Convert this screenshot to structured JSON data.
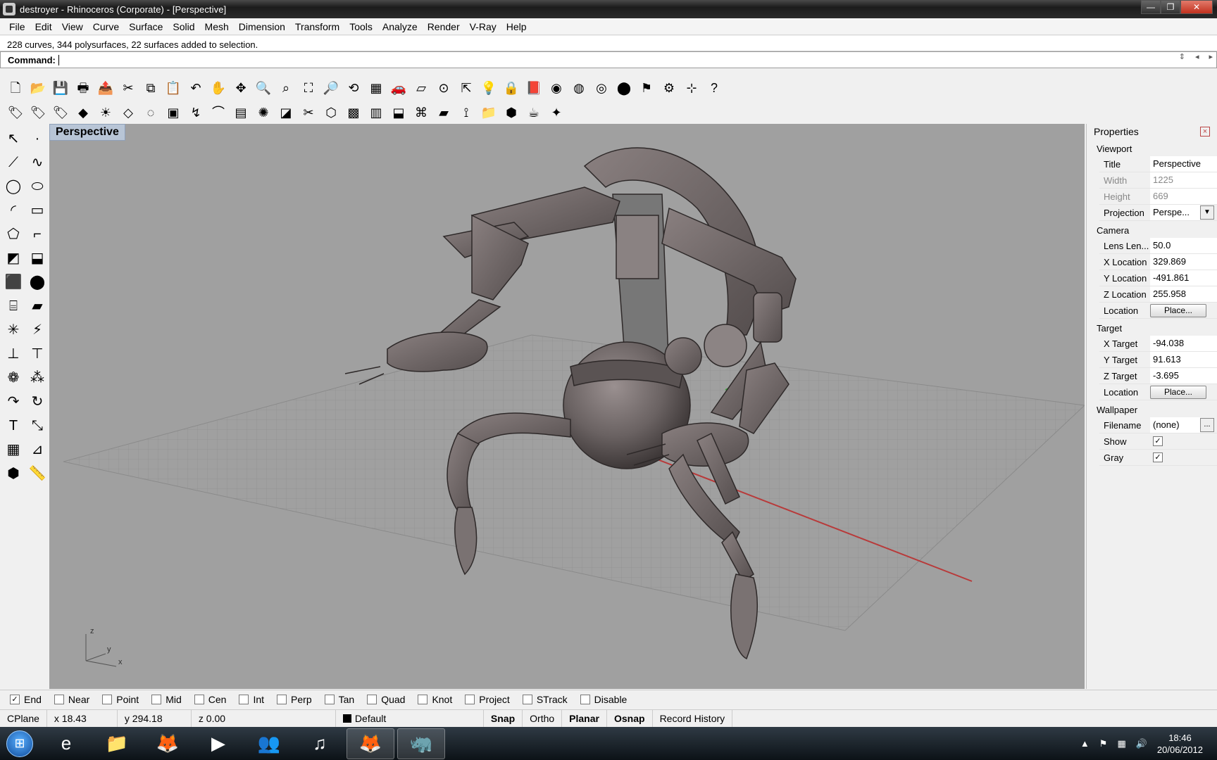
{
  "window": {
    "title": "destroyer - Rhinoceros (Corporate) - [Perspective]"
  },
  "menu": [
    "File",
    "Edit",
    "View",
    "Curve",
    "Surface",
    "Solid",
    "Mesh",
    "Dimension",
    "Transform",
    "Tools",
    "Analyze",
    "Render",
    "V-Ray",
    "Help"
  ],
  "command": {
    "history": "228 curves, 344 polysurfaces, 22 surfaces added to selection.",
    "prompt": "Command:"
  },
  "toolbar1": [
    {
      "icon": "new-icon",
      "glyph": "🗋"
    },
    {
      "icon": "open-icon",
      "glyph": "📂"
    },
    {
      "icon": "save-icon",
      "glyph": "💾"
    },
    {
      "icon": "print-icon",
      "glyph": "🖶"
    },
    {
      "icon": "export-icon",
      "glyph": "📤"
    },
    {
      "icon": "cut-icon",
      "glyph": "✂"
    },
    {
      "icon": "copy-icon",
      "glyph": "⧉"
    },
    {
      "icon": "paste-icon",
      "glyph": "📋"
    },
    {
      "icon": "undo-icon",
      "glyph": "↶"
    },
    {
      "icon": "pan-icon",
      "glyph": "✋"
    },
    {
      "icon": "rotate-view-icon",
      "glyph": "✥"
    },
    {
      "icon": "zoom-icon",
      "glyph": "🔍"
    },
    {
      "icon": "zoom-window-icon",
      "glyph": "⌕"
    },
    {
      "icon": "zoom-extents-icon",
      "glyph": "⛶"
    },
    {
      "icon": "zoom-selected-icon",
      "glyph": "🔎"
    },
    {
      "icon": "undo-view-icon",
      "glyph": "⟲"
    },
    {
      "icon": "four-viewports-icon",
      "glyph": "▦"
    },
    {
      "icon": "render-preview-icon",
      "glyph": "🚗"
    },
    {
      "icon": "cplane-icon",
      "glyph": "▱"
    },
    {
      "icon": "point-on-icon",
      "glyph": "⊙"
    },
    {
      "icon": "gumball-icon",
      "glyph": "⇱"
    },
    {
      "icon": "light-icon",
      "glyph": "💡"
    },
    {
      "icon": "lock-icon",
      "glyph": "🔒"
    },
    {
      "icon": "layer-icon",
      "glyph": "📕"
    },
    {
      "icon": "color-wheel-icon",
      "glyph": "◉"
    },
    {
      "icon": "wireframe-icon",
      "glyph": "◍"
    },
    {
      "icon": "shaded-icon",
      "glyph": "◎"
    },
    {
      "icon": "render-sphere-icon",
      "glyph": "⬤"
    },
    {
      "icon": "flag-icon",
      "glyph": "⚑"
    },
    {
      "icon": "options-gear-icon",
      "glyph": "⚙"
    },
    {
      "icon": "dimension-icon",
      "glyph": "⊹"
    },
    {
      "icon": "help-icon",
      "glyph": "?"
    }
  ],
  "toolbar2": [
    {
      "icon": "tag-icon",
      "glyph": "🏷"
    },
    {
      "icon": "tag-edit-icon",
      "glyph": "🏷"
    },
    {
      "icon": "tag-remove-icon",
      "glyph": "🏷"
    },
    {
      "icon": "cube-small-icon",
      "glyph": "◆"
    },
    {
      "icon": "sun-icon",
      "glyph": "☀"
    },
    {
      "icon": "material-icon",
      "glyph": "◇"
    },
    {
      "icon": "env-sphere-icon",
      "glyph": "◌"
    },
    {
      "icon": "vray-frame-icon",
      "glyph": "▣"
    },
    {
      "icon": "vray-light-icon",
      "glyph": "↯"
    },
    {
      "icon": "vray-dome-icon",
      "glyph": "⌒"
    },
    {
      "icon": "vray-proxy-icon",
      "glyph": "▤"
    },
    {
      "icon": "vray-fur-icon",
      "glyph": "✺"
    },
    {
      "icon": "vray-plane-icon",
      "glyph": "◪"
    },
    {
      "icon": "vray-cut-icon",
      "glyph": "✂"
    },
    {
      "icon": "vray-mesh-icon",
      "glyph": "⬡"
    },
    {
      "icon": "vray-box-icon",
      "glyph": "▩"
    },
    {
      "icon": "vray-clipper-icon",
      "glyph": "▥"
    },
    {
      "icon": "vray-export-icon",
      "glyph": "⬓"
    },
    {
      "icon": "vray-infinite-icon",
      "glyph": "⌘"
    },
    {
      "icon": "vray-decal-icon",
      "glyph": "▰"
    },
    {
      "icon": "vray-axis-icon",
      "glyph": "⟟"
    },
    {
      "icon": "folder-icon",
      "glyph": "📁"
    },
    {
      "icon": "vray-cube-icon",
      "glyph": "⬢"
    },
    {
      "icon": "vray-teapot-icon",
      "glyph": "☕"
    },
    {
      "icon": "vray-scatter-icon",
      "glyph": "✦"
    }
  ],
  "left_tools": [
    {
      "icon": "select-arrow-icon",
      "glyph": "↖"
    },
    {
      "icon": "point-icon",
      "glyph": "·"
    },
    {
      "icon": "polyline-icon",
      "glyph": "⟋"
    },
    {
      "icon": "curve-icon",
      "glyph": "∿"
    },
    {
      "icon": "circle-icon",
      "glyph": "◯"
    },
    {
      "icon": "ellipse-icon",
      "glyph": "⬭"
    },
    {
      "icon": "arc-icon",
      "glyph": "◜"
    },
    {
      "icon": "rectangle-icon",
      "glyph": "▭"
    },
    {
      "icon": "polygon-icon",
      "glyph": "⬠"
    },
    {
      "icon": "fillet-icon",
      "glyph": "⌐"
    },
    {
      "icon": "surface-corner-icon",
      "glyph": "◩"
    },
    {
      "icon": "extrude-surface-icon",
      "glyph": "⬓"
    },
    {
      "icon": "box-icon",
      "glyph": "⬛"
    },
    {
      "icon": "boolean-icon",
      "glyph": "⬤"
    },
    {
      "icon": "cylinder-icon",
      "glyph": "⌸"
    },
    {
      "icon": "plane-surface-icon",
      "glyph": "▰"
    },
    {
      "icon": "explode-icon",
      "glyph": "✳"
    },
    {
      "icon": "trim-icon",
      "glyph": "⚡"
    },
    {
      "icon": "split-icon",
      "glyph": "⊥"
    },
    {
      "icon": "join-icon",
      "glyph": "⊤"
    },
    {
      "icon": "group-icon",
      "glyph": "❁"
    },
    {
      "icon": "array-icon",
      "glyph": "⁂"
    },
    {
      "icon": "move-icon",
      "glyph": "↷"
    },
    {
      "icon": "rotate-icon",
      "glyph": "↻"
    },
    {
      "icon": "text-icon",
      "glyph": "T"
    },
    {
      "icon": "scale-icon",
      "glyph": "⤡"
    },
    {
      "icon": "grid-array-icon",
      "glyph": "▦"
    },
    {
      "icon": "dimension-tool-icon",
      "glyph": "⊿"
    },
    {
      "icon": "solid-cube-icon",
      "glyph": "⬢"
    },
    {
      "icon": "ruler-icon",
      "glyph": "📏"
    }
  ],
  "viewport": {
    "label": "Perspective",
    "axis_z": "z",
    "axis_y": "y",
    "axis_x": "x"
  },
  "properties": {
    "panel_title": "Properties",
    "close": "×",
    "section_viewport": "Viewport",
    "title_k": "Title",
    "title_v": "Perspective",
    "width_k": "Width",
    "width_v": "1225",
    "height_k": "Height",
    "height_v": "669",
    "projection_k": "Projection",
    "projection_v": "Perspe...",
    "section_camera": "Camera",
    "lens_k": "Lens Len...",
    "lens_v": "50.0",
    "xloc_k": "X Location",
    "xloc_v": "329.869",
    "yloc_k": "Y Location",
    "yloc_v": "-491.861",
    "zloc_k": "Z Location",
    "zloc_v": "255.958",
    "loc_k": "Location",
    "place_btn": "Place...",
    "section_target": "Target",
    "xt_k": "X Target",
    "xt_v": "-94.038",
    "yt_k": "Y Target",
    "yt_v": "91.613",
    "zt_k": "Z Target",
    "zt_v": "-3.695",
    "loc2_k": "Location",
    "place_btn2": "Place...",
    "section_wallpaper": "Wallpaper",
    "file_k": "Filename",
    "file_v": "(none)",
    "ellipsis": "...",
    "show_k": "Show",
    "gray_k": "Gray",
    "check": "✓"
  },
  "osnap": [
    {
      "label": "End",
      "checked": true
    },
    {
      "label": "Near",
      "checked": false
    },
    {
      "label": "Point",
      "checked": false
    },
    {
      "label": "Mid",
      "checked": false
    },
    {
      "label": "Cen",
      "checked": false
    },
    {
      "label": "Int",
      "checked": false
    },
    {
      "label": "Perp",
      "checked": false
    },
    {
      "label": "Tan",
      "checked": false
    },
    {
      "label": "Quad",
      "checked": false
    },
    {
      "label": "Knot",
      "checked": false
    },
    {
      "label": "Project",
      "checked": false
    },
    {
      "label": "STrack",
      "checked": false
    },
    {
      "label": "Disable",
      "checked": false
    }
  ],
  "status": {
    "cplane": "CPlane",
    "x": "x 18.43",
    "y": "y 294.18",
    "z": "z 0.00",
    "layer": "Default",
    "snap": "Snap",
    "ortho": "Ortho",
    "planar": "Planar",
    "osnap": "Osnap",
    "record": "Record History"
  },
  "taskbar": {
    "apps": [
      {
        "icon": "ie-icon",
        "glyph": "e",
        "active": false
      },
      {
        "icon": "explorer-icon",
        "glyph": "📁",
        "active": false
      },
      {
        "icon": "firefox-icon",
        "glyph": "🦊",
        "active": false
      },
      {
        "icon": "media-player-icon",
        "glyph": "▶",
        "active": false
      },
      {
        "icon": "messenger-icon",
        "glyph": "👥",
        "active": false
      },
      {
        "icon": "itunes-icon",
        "glyph": "♫",
        "active": false
      },
      {
        "icon": "firefox-2-icon",
        "glyph": "🦊",
        "active": true
      },
      {
        "icon": "rhino-icon",
        "glyph": "🦏",
        "active": true
      }
    ],
    "time": "18:46",
    "date": "20/06/2012"
  }
}
